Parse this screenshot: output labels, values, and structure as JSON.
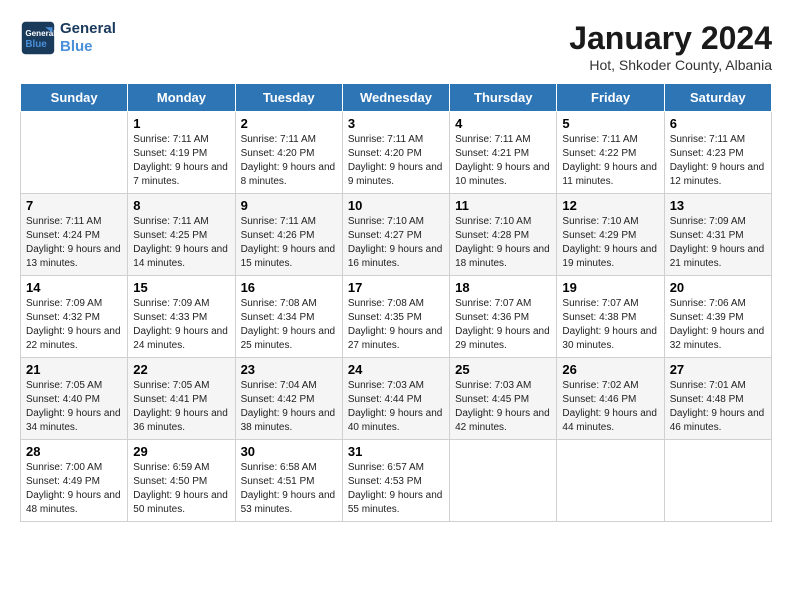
{
  "header": {
    "logo": {
      "line1": "General",
      "line2": "Blue"
    },
    "title": "January 2024",
    "location": "Hot, Shkoder County, Albania"
  },
  "days_of_week": [
    "Sunday",
    "Monday",
    "Tuesday",
    "Wednesday",
    "Thursday",
    "Friday",
    "Saturday"
  ],
  "weeks": [
    [
      {
        "date": "",
        "sunrise": "",
        "sunset": "",
        "daylight": ""
      },
      {
        "date": "1",
        "sunrise": "Sunrise: 7:11 AM",
        "sunset": "Sunset: 4:19 PM",
        "daylight": "Daylight: 9 hours and 7 minutes."
      },
      {
        "date": "2",
        "sunrise": "Sunrise: 7:11 AM",
        "sunset": "Sunset: 4:20 PM",
        "daylight": "Daylight: 9 hours and 8 minutes."
      },
      {
        "date": "3",
        "sunrise": "Sunrise: 7:11 AM",
        "sunset": "Sunset: 4:20 PM",
        "daylight": "Daylight: 9 hours and 9 minutes."
      },
      {
        "date": "4",
        "sunrise": "Sunrise: 7:11 AM",
        "sunset": "Sunset: 4:21 PM",
        "daylight": "Daylight: 9 hours and 10 minutes."
      },
      {
        "date": "5",
        "sunrise": "Sunrise: 7:11 AM",
        "sunset": "Sunset: 4:22 PM",
        "daylight": "Daylight: 9 hours and 11 minutes."
      },
      {
        "date": "6",
        "sunrise": "Sunrise: 7:11 AM",
        "sunset": "Sunset: 4:23 PM",
        "daylight": "Daylight: 9 hours and 12 minutes."
      }
    ],
    [
      {
        "date": "7",
        "sunrise": "Sunrise: 7:11 AM",
        "sunset": "Sunset: 4:24 PM",
        "daylight": "Daylight: 9 hours and 13 minutes."
      },
      {
        "date": "8",
        "sunrise": "Sunrise: 7:11 AM",
        "sunset": "Sunset: 4:25 PM",
        "daylight": "Daylight: 9 hours and 14 minutes."
      },
      {
        "date": "9",
        "sunrise": "Sunrise: 7:11 AM",
        "sunset": "Sunset: 4:26 PM",
        "daylight": "Daylight: 9 hours and 15 minutes."
      },
      {
        "date": "10",
        "sunrise": "Sunrise: 7:10 AM",
        "sunset": "Sunset: 4:27 PM",
        "daylight": "Daylight: 9 hours and 16 minutes."
      },
      {
        "date": "11",
        "sunrise": "Sunrise: 7:10 AM",
        "sunset": "Sunset: 4:28 PM",
        "daylight": "Daylight: 9 hours and 18 minutes."
      },
      {
        "date": "12",
        "sunrise": "Sunrise: 7:10 AM",
        "sunset": "Sunset: 4:29 PM",
        "daylight": "Daylight: 9 hours and 19 minutes."
      },
      {
        "date": "13",
        "sunrise": "Sunrise: 7:09 AM",
        "sunset": "Sunset: 4:31 PM",
        "daylight": "Daylight: 9 hours and 21 minutes."
      }
    ],
    [
      {
        "date": "14",
        "sunrise": "Sunrise: 7:09 AM",
        "sunset": "Sunset: 4:32 PM",
        "daylight": "Daylight: 9 hours and 22 minutes."
      },
      {
        "date": "15",
        "sunrise": "Sunrise: 7:09 AM",
        "sunset": "Sunset: 4:33 PM",
        "daylight": "Daylight: 9 hours and 24 minutes."
      },
      {
        "date": "16",
        "sunrise": "Sunrise: 7:08 AM",
        "sunset": "Sunset: 4:34 PM",
        "daylight": "Daylight: 9 hours and 25 minutes."
      },
      {
        "date": "17",
        "sunrise": "Sunrise: 7:08 AM",
        "sunset": "Sunset: 4:35 PM",
        "daylight": "Daylight: 9 hours and 27 minutes."
      },
      {
        "date": "18",
        "sunrise": "Sunrise: 7:07 AM",
        "sunset": "Sunset: 4:36 PM",
        "daylight": "Daylight: 9 hours and 29 minutes."
      },
      {
        "date": "19",
        "sunrise": "Sunrise: 7:07 AM",
        "sunset": "Sunset: 4:38 PM",
        "daylight": "Daylight: 9 hours and 30 minutes."
      },
      {
        "date": "20",
        "sunrise": "Sunrise: 7:06 AM",
        "sunset": "Sunset: 4:39 PM",
        "daylight": "Daylight: 9 hours and 32 minutes."
      }
    ],
    [
      {
        "date": "21",
        "sunrise": "Sunrise: 7:05 AM",
        "sunset": "Sunset: 4:40 PM",
        "daylight": "Daylight: 9 hours and 34 minutes."
      },
      {
        "date": "22",
        "sunrise": "Sunrise: 7:05 AM",
        "sunset": "Sunset: 4:41 PM",
        "daylight": "Daylight: 9 hours and 36 minutes."
      },
      {
        "date": "23",
        "sunrise": "Sunrise: 7:04 AM",
        "sunset": "Sunset: 4:42 PM",
        "daylight": "Daylight: 9 hours and 38 minutes."
      },
      {
        "date": "24",
        "sunrise": "Sunrise: 7:03 AM",
        "sunset": "Sunset: 4:44 PM",
        "daylight": "Daylight: 9 hours and 40 minutes."
      },
      {
        "date": "25",
        "sunrise": "Sunrise: 7:03 AM",
        "sunset": "Sunset: 4:45 PM",
        "daylight": "Daylight: 9 hours and 42 minutes."
      },
      {
        "date": "26",
        "sunrise": "Sunrise: 7:02 AM",
        "sunset": "Sunset: 4:46 PM",
        "daylight": "Daylight: 9 hours and 44 minutes."
      },
      {
        "date": "27",
        "sunrise": "Sunrise: 7:01 AM",
        "sunset": "Sunset: 4:48 PM",
        "daylight": "Daylight: 9 hours and 46 minutes."
      }
    ],
    [
      {
        "date": "28",
        "sunrise": "Sunrise: 7:00 AM",
        "sunset": "Sunset: 4:49 PM",
        "daylight": "Daylight: 9 hours and 48 minutes."
      },
      {
        "date": "29",
        "sunrise": "Sunrise: 6:59 AM",
        "sunset": "Sunset: 4:50 PM",
        "daylight": "Daylight: 9 hours and 50 minutes."
      },
      {
        "date": "30",
        "sunrise": "Sunrise: 6:58 AM",
        "sunset": "Sunset: 4:51 PM",
        "daylight": "Daylight: 9 hours and 53 minutes."
      },
      {
        "date": "31",
        "sunrise": "Sunrise: 6:57 AM",
        "sunset": "Sunset: 4:53 PM",
        "daylight": "Daylight: 9 hours and 55 minutes."
      },
      {
        "date": "",
        "sunrise": "",
        "sunset": "",
        "daylight": ""
      },
      {
        "date": "",
        "sunrise": "",
        "sunset": "",
        "daylight": ""
      },
      {
        "date": "",
        "sunrise": "",
        "sunset": "",
        "daylight": ""
      }
    ]
  ]
}
